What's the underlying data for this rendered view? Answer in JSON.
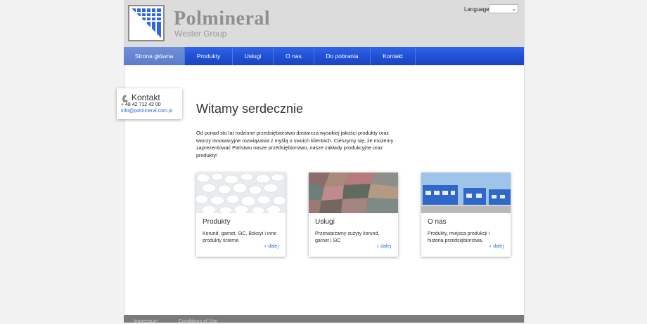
{
  "header": {
    "logo_name": "Polmineral",
    "logo_sub": "Wester Group",
    "language_label": "Language",
    "language_value": ""
  },
  "nav": {
    "items": [
      {
        "label": "Strona główna",
        "active": true
      },
      {
        "label": "Produkty"
      },
      {
        "label": "Usługi"
      },
      {
        "label": "O nas"
      },
      {
        "label": "Do pobrania"
      },
      {
        "label": "Kontakt"
      }
    ]
  },
  "contact": {
    "title": "Kontakt",
    "phone": "+ 48 42 712 42 00",
    "email": "info@polmineral.com.pl"
  },
  "main": {
    "heading": "Witamy serdecznie",
    "intro": "Od ponad stu lat rodzinne przedsiębiorstwo dostarcza wysokiej jakości produkty oraz tworzy innowacyjne rozwiązania z myślą o swoich klientach. Cieszymy się, że możemy zaprezentować Państwu nasze przedsiębiorstwo, nasze zakłady produkcyjne oraz produkty!"
  },
  "cards": [
    {
      "title": "Produkty",
      "desc": "Korund, garnet, SiC, Boksyt i inne produkty ścierne",
      "more": "dalej"
    },
    {
      "title": "Usługi",
      "desc": "Przetwarzamy zużyty korund, garnet i SiC",
      "more": "dalej"
    },
    {
      "title": "O nas",
      "desc": "Produkty, miejsca produkcji i historia przedsiębiorstwa.",
      "more": "dalej"
    }
  ],
  "footer": {
    "link1": "Impressum",
    "link2": "Conditions of Use"
  },
  "colors": {
    "nav_blue": "#1f4fd4",
    "link_blue": "#2a6ad1",
    "header_gray": "#dcdcdc"
  }
}
